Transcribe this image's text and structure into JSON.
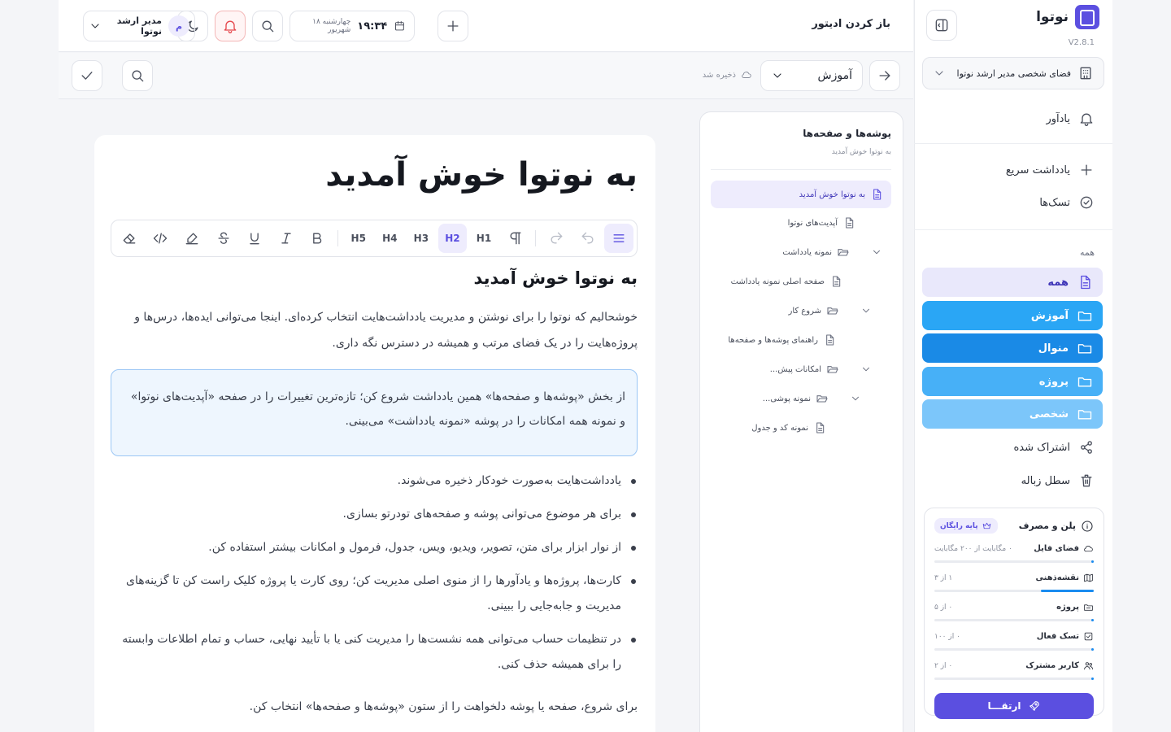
{
  "app": {
    "name": "نوتوا",
    "version": "V2.8.1"
  },
  "sidebar": {
    "workspace": "فضای شخصی مدیر ارشد نوتوا",
    "reminder": "یادآور",
    "quick_note": "یادداشت سریع",
    "tasks": "تسک‌ها",
    "section_title": "همه",
    "folders": [
      {
        "label": "همه",
        "color": "#e9e8fb"
      },
      {
        "label": "آموزش",
        "color": "#2aa6f5"
      },
      {
        "label": "منوال",
        "color": "#1a8ae6"
      },
      {
        "label": "پروژه",
        "color": "#47b0f7"
      },
      {
        "label": "شخصی",
        "color": "#7cc6fa"
      }
    ],
    "shared": "اشتراک شده",
    "trash": "سطل زباله",
    "plan": {
      "title": "پلن و مصرف",
      "badge": "پایه رایگان",
      "rows": [
        {
          "label": "فضای فایل",
          "value": "۰ مگابایت از ۲۰۰ مگابایت",
          "fraction": 0.01
        },
        {
          "label": "نقشه‌ذهنی",
          "value": "۱ از ۳",
          "fraction": 0.33
        },
        {
          "label": "پروژه",
          "value": "۰ از ۵",
          "fraction": 0.01
        },
        {
          "label": "تسک فعال",
          "value": "۰ از ۱۰۰",
          "fraction": 0.01
        },
        {
          "label": "کاربر مشترک",
          "value": "۰ از ۲",
          "fraction": 0.01
        }
      ],
      "upgrade": "ارتقـــا"
    }
  },
  "topbar": {
    "title": "باز کردن ادیتور",
    "time": "۱۹:۳۴",
    "date": "چهارشنبه ۱۸ شهریور",
    "user_initial": "م",
    "user_name": "مدیر ارشد نوتوا"
  },
  "toolbar2": {
    "folder": "آموزش",
    "saved": "ذخیره شد"
  },
  "pages": {
    "title": "پوشه‌ها و صفحه‌ها",
    "subtitle": "به نوتوا خوش آمدید",
    "items": [
      {
        "label": "به نوتوا خوش آمدید",
        "type": "page"
      },
      {
        "label": "آپدیت‌های نوتوا",
        "type": "page"
      },
      {
        "label": "نمونه یادداشت",
        "type": "folder"
      },
      {
        "label": "صفحه اصلی نمونه یادداشت",
        "type": "page"
      },
      {
        "label": "شروع کار",
        "type": "folder"
      },
      {
        "label": "راهنمای پوشه‌ها و صفحه‌ها",
        "type": "page"
      },
      {
        "label": "امکانات پیش...",
        "type": "folder"
      },
      {
        "label": "نمونه پوشی...",
        "type": "folder"
      },
      {
        "label": "نمونه کد و جدول",
        "type": "page"
      }
    ]
  },
  "editor": {
    "title": "به نوتوا خوش آمدید",
    "toolbar": {
      "h1": "H1",
      "h2": "H2",
      "h3": "H3",
      "h4": "H4",
      "h5": "H5"
    },
    "heading": "به نوتوا خوش آمدید",
    "paragraph": "خوشحالیم که نوتوا را برای نوشتن و مدیریت یادداشت‌هایت انتخاب کرده‌ای. اینجا می‌توانی ایده‌ها، درس‌ها و پروژه‌هایت را در یک فضای مرتب و همیشه در دسترس نگه داری.",
    "callout": "از بخش «پوشه‌ها و صفحه‌ها» همین یادداشت شروع کن؛ تازه‌ترین تغییرات را در صفحه «آپدیت‌های نوتوا» و نمونه همه امکانات را در پوشه «نمونه یادداشت» می‌بینی.",
    "bullets": [
      "یادداشت‌هایت به‌صورت خودکار ذخیره می‌شوند.",
      "برای هر موضوع می‌توانی پوشه و صفحه‌های تودرتو بسازی.",
      "از نوار ابزار برای متن، تصویر، ویدیو، ویس، جدول، فرمول و امکانات بیشتر استفاده کن.",
      "کارت‌ها، پروژه‌ها و یادآورها را از منوی اصلی مدیریت کن؛ روی کارت یا پروژه کلیک راست کن تا گزینه‌های مدیریت و جابه‌جایی را ببینی.",
      "در تنظیمات حساب می‌توانی همه نشست‌ها را مدیریت کنی یا با تأیید نهایی، حساب و تمام اطلاعات وابسته را برای همیشه حذف کنی."
    ],
    "closing": "برای شروع، صفحه یا پوشه دلخواهت را از ستون «پوشه‌ها و صفحه‌ها» انتخاب کن."
  }
}
